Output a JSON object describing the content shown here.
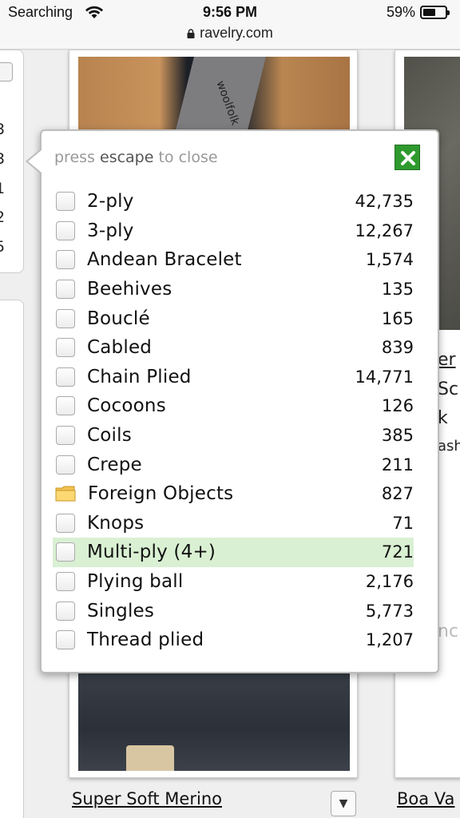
{
  "status_bar": {
    "carrier": "Searching",
    "time": "9:56 PM",
    "battery": "59%",
    "battery_level": 0.59,
    "url": "ravelry.com"
  },
  "background": {
    "side_numbers": [
      "3",
      "3",
      "1",
      "2",
      "5"
    ],
    "right_fragments": [
      "er",
      "Sc",
      "k",
      "ash",
      "nc"
    ],
    "card_left_title": "Super Soft Merino",
    "card_right_title": "Boa Va",
    "photo_tag_text": "woolfolk"
  },
  "popover": {
    "hint_prefix": "press",
    "hint_key": "escape",
    "hint_suffix": "to close",
    "close_icon": "close-x-icon",
    "options": [
      {
        "label": "2-ply",
        "count": "42,735",
        "icon": "checkbox"
      },
      {
        "label": "3-ply",
        "count": "12,267",
        "icon": "checkbox"
      },
      {
        "label": "Andean Bracelet",
        "count": "1,574",
        "icon": "checkbox"
      },
      {
        "label": "Beehives",
        "count": "135",
        "icon": "checkbox"
      },
      {
        "label": "Bouclé",
        "count": "165",
        "icon": "checkbox"
      },
      {
        "label": "Cabled",
        "count": "839",
        "icon": "checkbox"
      },
      {
        "label": "Chain Plied",
        "count": "14,771",
        "icon": "checkbox"
      },
      {
        "label": "Cocoons",
        "count": "126",
        "icon": "checkbox"
      },
      {
        "label": "Coils",
        "count": "385",
        "icon": "checkbox"
      },
      {
        "label": "Crepe",
        "count": "211",
        "icon": "checkbox"
      },
      {
        "label": "Foreign Objects",
        "count": "827",
        "icon": "folder"
      },
      {
        "label": "Knops",
        "count": "71",
        "icon": "checkbox"
      },
      {
        "label": "Multi-ply (4+)",
        "count": "721",
        "icon": "checkbox",
        "highlighted": true
      },
      {
        "label": "Plying ball",
        "count": "2,176",
        "icon": "checkbox"
      },
      {
        "label": "Singles",
        "count": "5,773",
        "icon": "checkbox"
      },
      {
        "label": "Thread plied",
        "count": "1,207",
        "icon": "checkbox"
      }
    ]
  },
  "colors": {
    "close_green": "#2e9a2e",
    "highlight": "#d9f0d3"
  }
}
